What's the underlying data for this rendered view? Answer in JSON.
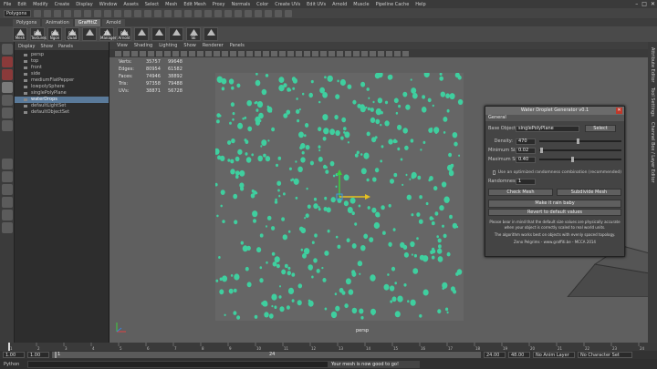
{
  "menubar": [
    "File",
    "Edit",
    "Modify",
    "Create",
    "Display",
    "Window",
    "Assets",
    "Select",
    "Mesh",
    "Edit Mesh",
    "Proxy",
    "Normals",
    "Color",
    "Create UVs",
    "Edit UVs",
    "Arnold",
    "Muscle",
    "Pipeline Cache",
    "Help"
  ],
  "statusline": {
    "mode": "Polygons"
  },
  "shelf_tabs": [
    "Polygons",
    "Animation",
    "GraffitiZ",
    "Arnold"
  ],
  "shelf_active": 2,
  "shelf_buttons": [
    "Mesh",
    "Rnd Textures",
    "Rnd Ngon",
    "Rnd Quad",
    "",
    "TX Manager",
    "Rnd Arnold",
    "",
    "",
    "",
    "SE",
    ""
  ],
  "outliner": {
    "menu": [
      "Display",
      "Show",
      "Panels"
    ],
    "items": [
      "persp",
      "top",
      "front",
      "side",
      "mediumFlatPepper",
      "lowpolySphere",
      "singlePolyPlane",
      "waterDrops",
      "defaultLightSet",
      "defaultObjectSet"
    ],
    "selected": 7
  },
  "viewport": {
    "menu": [
      "View",
      "Shading",
      "Lighting",
      "Show",
      "Renderer",
      "Panels"
    ],
    "hud": [
      {
        "k": "Verts:",
        "a": "35757",
        "b": "99648"
      },
      {
        "k": "Edges:",
        "a": "80954",
        "b": "61582"
      },
      {
        "k": "Faces:",
        "a": "74946",
        "b": "38892"
      },
      {
        "k": "Tris:",
        "a": "97358",
        "b": "79488"
      },
      {
        "k": "UVs:",
        "a": "38871",
        "b": "56728"
      }
    ],
    "camera": "persp",
    "drop_color": "#3fcf9f"
  },
  "plugin": {
    "title": "Water Droplet Generator v0.1",
    "section": "General",
    "base_object_label": "Base Object:",
    "base_object_value": "singlePolyPlane",
    "select_label": "Select",
    "density_label": "Density:",
    "density_value": "470",
    "density_pct": 0.47,
    "min_size_label": "Minimum Size:",
    "min_size_value": "0.02",
    "min_size_pct": 0.02,
    "max_size_label": "Maximum Size:",
    "max_size_value": "0.40",
    "max_size_pct": 0.4,
    "optimized_label": "Use an optimized randomness combination (recommended)",
    "randomness_label": "Randomness:",
    "randomness_value": "1",
    "check_mesh_label": "Check Mesh",
    "subdivide_mesh_label": "Subdivide Mesh",
    "make_label": "Make it rain baby",
    "reset_label": "Revert to default values",
    "note1": "Please bear in mind that the default size values are physically accurate when your object is correctly scaled to real world units.",
    "note2": "The algorithm works best on objects with evenly spaced topology.",
    "credit": "Zeno Pelgrims - www.graffiti.be - MCCA 2014"
  },
  "dock": [
    "Attribute Editor",
    "Tool Settings",
    "Channel Box / Layer Editor"
  ],
  "timeline": {
    "tick_labels": [
      "1",
      "2",
      "3",
      "4",
      "5",
      "6",
      "7",
      "8",
      "9",
      "10",
      "11",
      "12",
      "13",
      "14",
      "15",
      "16",
      "17",
      "18",
      "19",
      "20",
      "21",
      "22",
      "23",
      "24"
    ]
  },
  "range": {
    "start": "1.00",
    "start2": "1.00",
    "current": "1",
    "range_end": "24",
    "end1": "24.00",
    "end2": "48.00",
    "anim_layer": "No Anim Layer",
    "char_set": "No Character Set"
  },
  "cmdline": {
    "tag": "Python",
    "result": "Your mesh is now good to go!"
  }
}
